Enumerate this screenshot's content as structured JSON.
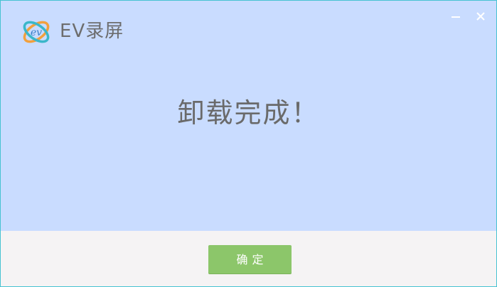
{
  "app": {
    "name": "EV录屏",
    "logo_icon": "ev-logo-icon"
  },
  "window_controls": {
    "minimize_icon": "minimize-icon",
    "close_icon": "close-icon"
  },
  "dialog": {
    "message": "卸载完成！",
    "confirm_label": "确定"
  },
  "colors": {
    "background": "#c9dcff",
    "footer": "#f5f3f4",
    "button": "#8cc66a",
    "border": "#46c3d2",
    "text": "#6a6a6a"
  }
}
